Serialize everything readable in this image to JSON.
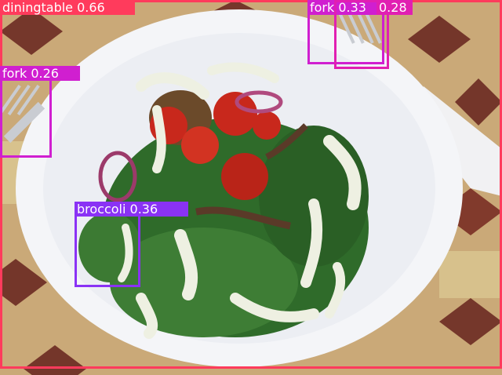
{
  "image": {
    "subject": "spinach salad with cherry tomatoes, red onion, shredded meat and creamy dressing on a white plate",
    "colors": {
      "table_tile_dark": "#6b2a22",
      "table_tile_light": "#d9c48f",
      "plate": "#f4f5f8",
      "spinach": "#2f6b2a",
      "tomato": "#c8281c",
      "dressing": "#eef0e2"
    }
  },
  "detections": [
    {
      "id": "diningtable",
      "label": "diningtable 0.66",
      "color": "#ff3b5c"
    },
    {
      "id": "fork-a",
      "label": "fork 0.33",
      "color": "#d01fd0"
    },
    {
      "id": "fork-b",
      "label": "0.28",
      "color": "#e11fb2"
    },
    {
      "id": "fork-c",
      "label": "fork 0.26",
      "color": "#d01fd0"
    },
    {
      "id": "broccoli",
      "label": "broccoli 0.36",
      "color": "#8a32f5"
    }
  ]
}
